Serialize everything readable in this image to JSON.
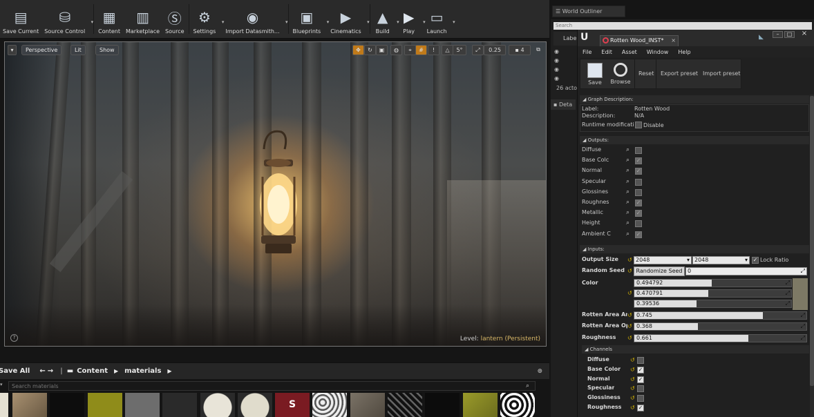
{
  "toolbar": {
    "items": [
      {
        "label": "Save Current",
        "icon": "save-icon"
      },
      {
        "label": "Source Control",
        "icon": "source-control-icon"
      },
      {
        "label": "Content",
        "icon": "content-icon"
      },
      {
        "label": "Marketplace",
        "icon": "marketplace-icon"
      },
      {
        "label": "Source",
        "icon": "source-icon"
      },
      {
        "label": "Settings",
        "icon": "settings-icon"
      },
      {
        "label": "Import Datasmith...",
        "icon": "datasmith-icon"
      },
      {
        "label": "Blueprints",
        "icon": "blueprints-icon"
      },
      {
        "label": "Cinematics",
        "icon": "cinematics-icon"
      },
      {
        "label": "Build",
        "icon": "build-icon"
      },
      {
        "label": "Play",
        "icon": "play-icon"
      },
      {
        "label": "Launch",
        "icon": "launch-icon"
      }
    ]
  },
  "viewport": {
    "view_mode": "Perspective",
    "lighting": "Lit",
    "show": "Show",
    "grid_angle": "5°",
    "camera_speed": "0.25",
    "snap_scale": "4",
    "level_label": "Level:",
    "level_name": "lantern (Persistent)"
  },
  "content_browser": {
    "save_all": "Save All",
    "path": [
      "Content",
      "materials"
    ],
    "search_placeholder": "Search materials"
  },
  "world_outliner": {
    "tab": "World Outliner",
    "search_placeholder": "Search",
    "column": "Labe",
    "actor_count": "26 acto",
    "details_tab": "Deta"
  },
  "substance": {
    "title": "Rotten Wood_INST*",
    "menu": [
      "File",
      "Edit",
      "Asset",
      "Window",
      "Help"
    ],
    "toolbar": {
      "save": "Save",
      "browse": "Browse",
      "reset": "Reset",
      "export": "Export preset",
      "import": "Import preset"
    },
    "graph_description": {
      "header": "Graph Description:",
      "label_key": "Label:",
      "label_val": "Rotten Wood",
      "description_key": "Description:",
      "description_val": "N/A",
      "runtime_key": "Runtime modificatio",
      "runtime_val": "Disable"
    },
    "outputs": {
      "header": "Outputs:",
      "items": [
        {
          "name": "Diffuse",
          "checked": false
        },
        {
          "name": "Base Colc",
          "checked": true
        },
        {
          "name": "Normal",
          "checked": true
        },
        {
          "name": "Specular",
          "checked": false
        },
        {
          "name": "Glossines",
          "checked": false
        },
        {
          "name": "Roughnes",
          "checked": true
        },
        {
          "name": "Metallic",
          "checked": true
        },
        {
          "name": "Height",
          "checked": false
        },
        {
          "name": "Ambient C",
          "checked": true
        }
      ]
    },
    "inputs": {
      "header": "Inputs:",
      "output_size_label": "Output Size",
      "output_size_x": "2048",
      "output_size_y": "2048",
      "lock_ratio": "Lock Ratio",
      "random_seed_label": "Random Seed",
      "randomize_button": "Randomize Seed",
      "random_seed_value": "0",
      "color_label": "Color",
      "color_values": [
        "0.494792",
        "0.470791",
        "0.39536"
      ],
      "rotten_area_amount_label": "Rotten Area Amo",
      "rotten_area_amount": "0.745",
      "rotten_area_opacity_label": "Rotten Area Opa",
      "rotten_area_opacity": "0.368",
      "roughness_label": "Roughness",
      "roughness": "0.661"
    },
    "channels": {
      "header": "Channels",
      "items": [
        {
          "name": "Diffuse",
          "checked": false
        },
        {
          "name": "Base Color",
          "checked": true
        },
        {
          "name": "Normal",
          "checked": true
        },
        {
          "name": "Specular",
          "checked": false
        },
        {
          "name": "Glossiness",
          "checked": false
        },
        {
          "name": "Roughness",
          "checked": true
        }
      ]
    }
  }
}
